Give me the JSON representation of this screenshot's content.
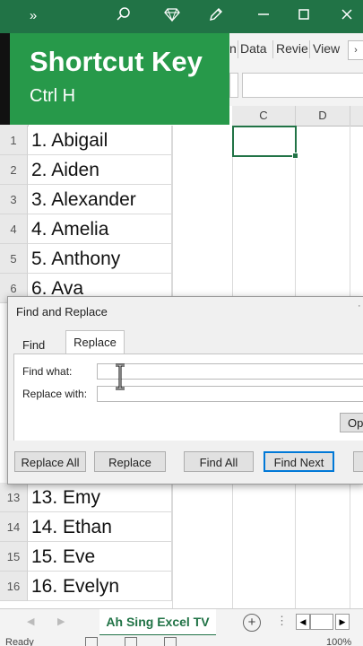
{
  "titlebar": {
    "icons": [
      "chevron-double-right-icon",
      "search-icon",
      "diamond-icon",
      "pen-icon",
      "minimize-icon",
      "maximize-icon",
      "close-icon"
    ],
    "accent": "#217346"
  },
  "ribbon": {
    "tabs": [
      "n",
      "Data",
      "Revie",
      "View"
    ]
  },
  "overlay": {
    "title": "Shortcut Key",
    "keys": "Ctrl H",
    "color": "#27994a"
  },
  "columns": [
    "C",
    "D"
  ],
  "rows": [
    {
      "num": "1",
      "a": "1. Abigail"
    },
    {
      "num": "2",
      "a": "2. Aiden"
    },
    {
      "num": "3",
      "a": "3. Alexander"
    },
    {
      "num": "4",
      "a": "4. Amelia"
    },
    {
      "num": "5",
      "a": "5. Anthony"
    },
    {
      "num": "6",
      "a": "6. Ava"
    },
    {
      "num": "13",
      "a": "13. Emy"
    },
    {
      "num": "14",
      "a": "14. Ethan"
    },
    {
      "num": "15",
      "a": "15. Eve"
    },
    {
      "num": "16",
      "a": "16. Evelyn"
    }
  ],
  "dialog": {
    "title": "Find and Replace",
    "tabs": {
      "find": "Find",
      "replace": "Replace"
    },
    "find_label": "Find what:",
    "replace_label": "Replace with:",
    "find_value": "",
    "replace_value": "",
    "options_label": "Op",
    "buttons": {
      "replace_all": "Replace All",
      "replace": "Replace",
      "find_all": "Find All",
      "find_next": "Find Next"
    }
  },
  "sheet": {
    "tab_label": "Ah Sing Excel TV"
  },
  "status": {
    "ready": "Ready",
    "zoom": "100%"
  }
}
